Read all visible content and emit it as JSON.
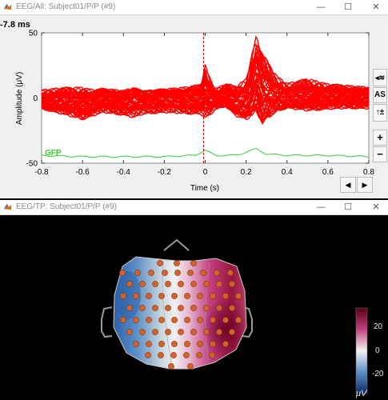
{
  "eeg_window": {
    "title": "EEG/All: Subject01/P/P (#9)",
    "current_time": "-7.8 ms",
    "gfp_label": "GFP",
    "side_buttons": {
      "display_mode": "◂≋",
      "autoscale": "AS",
      "scale_toggle": "↑±",
      "zoom_in": "+",
      "zoom_out": "−"
    },
    "nav": {
      "prev": "◀",
      "next": "▶"
    },
    "colors": {
      "channels": "#ff0000",
      "gfp": "#33cc33",
      "cursor": "#cc0000"
    }
  },
  "topo_window": {
    "title": "EEG/TP: Subject01/P/P (#9)",
    "colorbar": {
      "ticks": [
        "20",
        "0",
        "-20"
      ],
      "unit": "μV"
    },
    "colors": {
      "electrode": "#d4622c",
      "positive": "#8b0a3a",
      "negative": "#1e4fa0"
    }
  },
  "window_controls": {
    "minimize": "—",
    "maximize": "☐",
    "close": "✕"
  },
  "chart_data": {
    "type": "line",
    "xlabel": "Time (s)",
    "ylabel": "Amplitude (μV)",
    "xlim": [
      -0.8,
      0.8
    ],
    "ylim": [
      -50,
      50
    ],
    "xticks": [
      "-0.8",
      "-0.6",
      "-0.4",
      "-0.2",
      "0",
      "0.2",
      "0.4",
      "0.6",
      "0.8"
    ],
    "yticks": [
      "50",
      "0",
      "-50"
    ],
    "cursor_time": -0.0078,
    "series_envelope": {
      "x": [
        -0.8,
        -0.7,
        -0.6,
        -0.55,
        -0.5,
        -0.4,
        -0.35,
        -0.3,
        -0.2,
        -0.1,
        -0.02,
        0.0,
        0.02,
        0.05,
        0.1,
        0.15,
        0.2,
        0.25,
        0.28,
        0.35,
        0.4,
        0.5,
        0.6,
        0.7,
        0.8
      ],
      "upper": [
        7,
        9,
        10,
        8,
        9,
        8,
        11,
        8,
        9,
        10,
        12,
        28,
        18,
        8,
        12,
        10,
        16,
        50,
        36,
        18,
        12,
        16,
        12,
        11,
        10
      ],
      "lower": [
        -10,
        -14,
        -18,
        -15,
        -12,
        -14,
        -16,
        -13,
        -12,
        -13,
        -14,
        -18,
        -16,
        -10,
        -8,
        -16,
        -20,
        -18,
        -26,
        -14,
        -10,
        -12,
        -10,
        -9,
        -9
      ]
    },
    "gfp": {
      "x": [
        -0.8,
        -0.6,
        -0.4,
        -0.2,
        -0.05,
        0.0,
        0.05,
        0.15,
        0.25,
        0.3,
        0.4,
        0.6,
        0.8
      ],
      "values": [
        -44,
        -45,
        -45,
        -45,
        -44,
        -40,
        -44,
        -44,
        -39,
        -43,
        -44,
        -44,
        -45
      ]
    }
  }
}
